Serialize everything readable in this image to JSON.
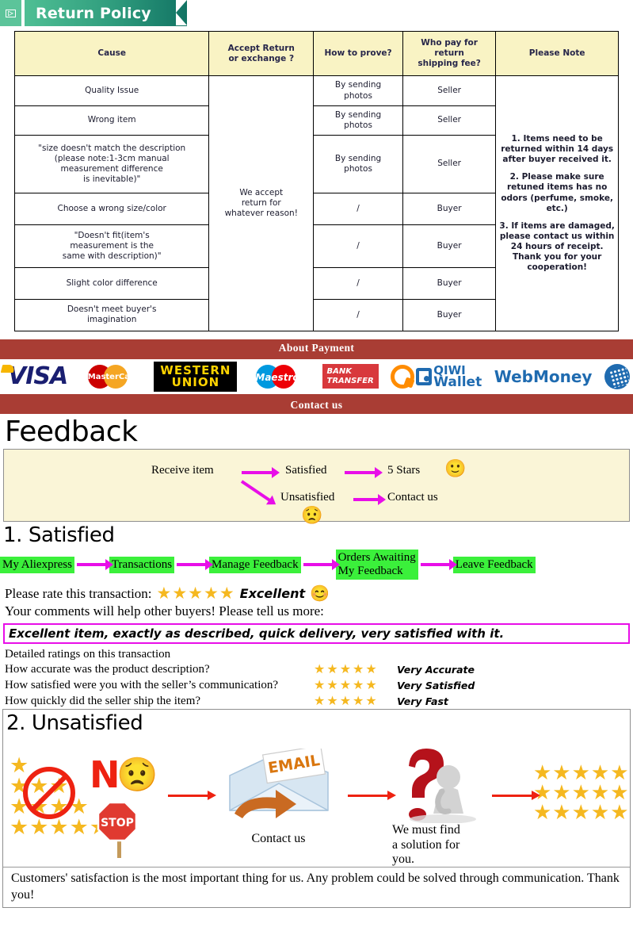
{
  "banner": {
    "icon": "mail-icon",
    "title": "Return Policy"
  },
  "policy_table": {
    "headers": [
      "Cause",
      "Accept Return\nor exchange ?",
      "How to prove?",
      "Who pay for return\nshipping fee?",
      "Please Note"
    ],
    "accept_cell": "We accept\nreturn for\nwhatever reason!",
    "rows": [
      {
        "cause": "Quality Issue",
        "prove": "By sending\nphotos",
        "who_pays": "Seller"
      },
      {
        "cause": "Wrong item",
        "prove": "By sending\nphotos",
        "who_pays": "Seller"
      },
      {
        "cause": "\"size doesn't match the description\n(please note:1-3cm manual\nmeasurement difference\nis inevitable)\"",
        "prove": "By sending\nphotos",
        "who_pays": "Seller"
      },
      {
        "cause": "Choose a wrong size/color",
        "prove": "/",
        "who_pays": "Buyer"
      },
      {
        "cause": "\"Doesn't fit(item's\nmeasurement is the\nsame with description)\"",
        "prove": "/",
        "who_pays": "Buyer"
      },
      {
        "cause": "Slight color difference",
        "prove": "/",
        "who_pays": "Buyer"
      },
      {
        "cause": "Doesn't meet buyer's\nimagination",
        "prove": "/",
        "who_pays": "Buyer"
      }
    ],
    "notes": [
      "1. Items need to be returned within 14 days after buyer received it.",
      "2. Please make sure retuned items has no odors (perfume, smoke, etc.)",
      "3. If items are damaged, please contact us within 24 hours of receipt.\nThank you for your cooperation!"
    ]
  },
  "payment": {
    "about_bar": "About Payment",
    "contact_bar": "Contact us",
    "logos": [
      {
        "name": "visa-logo",
        "label": "VISA"
      },
      {
        "name": "mastercard-logo",
        "label": "MasterCard"
      },
      {
        "name": "western-union-logo",
        "label": "WESTERN\nUNION"
      },
      {
        "name": "maestro-logo",
        "label": "Maestro"
      },
      {
        "name": "bank-transfer-logo",
        "label": "BANK\nTRANSFER"
      },
      {
        "name": "qiwi-wallet-logo",
        "label": "QIWI Wallet"
      },
      {
        "name": "webmoney-logo",
        "label": "WebMoney"
      }
    ],
    "western_union_line1": "WESTERN",
    "western_union_line2": "UNION",
    "bank_line1": "BANK",
    "bank_line2": "TRANSFER",
    "qiwi_line1": "QIWI",
    "qiwi_line2": "Wallet",
    "webmoney_label": "WebMoney",
    "visa_label": "VISA",
    "mastercard_label": "MasterCard",
    "maestro_label": "Maestro"
  },
  "feedback": {
    "title": "Feedback",
    "flow": {
      "receive_item": "Receive item",
      "satisfied": "Satisfied",
      "five_stars": "5 Stars",
      "unsatisfied": "Unsatisfied",
      "contact_us": "Contact us",
      "happy_emoji": "🙂",
      "sad_emoji": "😟"
    }
  },
  "satisfied": {
    "title": "1. Satisfied",
    "steps": [
      "My Aliexpress",
      "Transactions",
      "Manage Feedback",
      "Orders Awaiting\nMy Feedback",
      "Leave Feedback"
    ],
    "rate_prompt": "Please rate this transaction:",
    "rate_stars": "★★★★★",
    "rate_label": "Excellent",
    "rate_emoji": "😊",
    "comments_prompt": "Your comments will help other buyers! Please tell us more:",
    "comment_text": "Excellent item, exactly as described, quick delivery, very satisfied with it.",
    "detail_head": "Detailed ratings on this transaction",
    "detail_rows": [
      {
        "question": "How accurate was the product description?",
        "stars": "★★★★★",
        "label": "Very Accurate"
      },
      {
        "question": "How satisfied were you with the seller’s communication?",
        "stars": "★★★★★",
        "label": "Very Satisfied"
      },
      {
        "question": "How quickly did the seller ship the item?",
        "stars": "★★★★★",
        "label": "Very Fast"
      }
    ]
  },
  "unsatisfied": {
    "title": "2. Unsatisfied",
    "no_text": "N",
    "stop_text": "STOP",
    "email_text": "EMAIL",
    "contact_caption": "Contact us",
    "solution_caption": "We must find\na solution for\nyou.",
    "bottom_note": "Customers' satisfaction is the most important thing for us. Any problem could be solved through communication. Thank you!"
  },
  "colors": {
    "banner_green": "#4fbf94",
    "banner_teal": "#127464",
    "table_header_yellow": "#f9f3c4",
    "red_bar": "#a93d34",
    "magenta": "#e80ee8",
    "green_step": "#3bf03b",
    "star_gold": "#f5b820",
    "red_arrow": "#ee2211",
    "cream": "#faf5d7"
  }
}
